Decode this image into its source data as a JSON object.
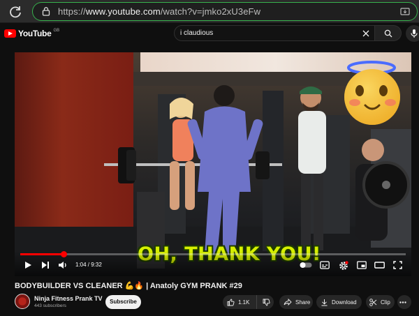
{
  "browser": {
    "url_prefix": "https://",
    "url_domain": "www.youtube.com",
    "url_path": "/watch?v=jmko2xU3eFw"
  },
  "header": {
    "logo_text": "YouTube",
    "logo_region": "GB",
    "search_query": "i claudious"
  },
  "player": {
    "caption": "OH, THANK YOU!",
    "time_display": "1:04 / 9:32",
    "progress": 0.112
  },
  "video": {
    "title": "BODYBUILDER VS CLEANER 💪🔥 | Anatoly GYM PRANK #29",
    "channel_name": "Ninja Fitness Prank TV",
    "subscribers": "443 subscribers",
    "subscribe_label": "Subscribe",
    "likes": "1.1K",
    "share_label": "Share",
    "download_label": "Download",
    "clip_label": "Clip"
  },
  "colors": {
    "accent": "#ff0000",
    "url_border": "#37b24d",
    "caption": "#d7f000"
  }
}
